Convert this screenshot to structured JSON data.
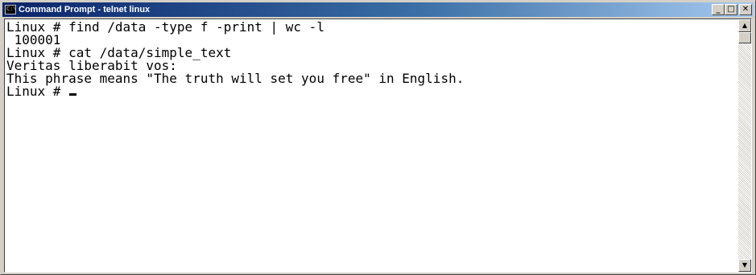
{
  "window": {
    "title": "Command Prompt - telnet linux",
    "icon": "console-icon",
    "buttons": {
      "minimize": "_",
      "maximize": "□",
      "close": "✕"
    }
  },
  "console": {
    "lines": [
      "Linux # find /data -type f -print | wc -l",
      " 100001",
      "Linux # cat /data/simple_text",
      "Veritas liberabit vos:",
      "This phrase means \"The truth will set you free\" in English.",
      "Linux # "
    ]
  },
  "scrollbar": {
    "up_icon": "arrow-up-icon",
    "down_icon": "arrow-down-icon",
    "up_glyph": "▲",
    "down_glyph": "▼"
  }
}
